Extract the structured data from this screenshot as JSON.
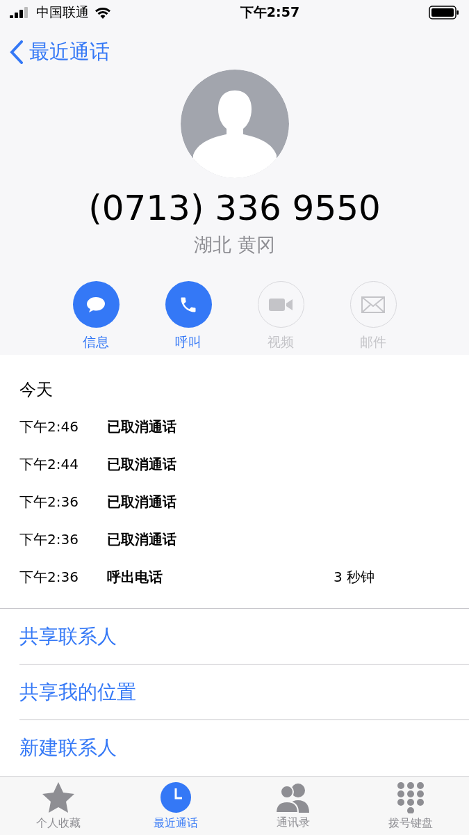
{
  "status_bar": {
    "carrier": "中国联通",
    "time": "下午2:57"
  },
  "nav": {
    "back_label": "最近通话"
  },
  "contact": {
    "number": "(0713) 336 9550",
    "location": "湖北 黄冈"
  },
  "actions": [
    {
      "kind": "message",
      "label": "信息",
      "disabled": false
    },
    {
      "kind": "call",
      "label": "呼叫",
      "disabled": false
    },
    {
      "kind": "video",
      "label": "视频",
      "disabled": true
    },
    {
      "kind": "mail",
      "label": "邮件",
      "disabled": true
    }
  ],
  "history": {
    "heading": "今天",
    "rows": [
      {
        "time": "下午2:46",
        "type": "已取消通话"
      },
      {
        "time": "下午2:44",
        "type": "已取消通话"
      },
      {
        "time": "下午2:36",
        "type": "已取消通话"
      },
      {
        "time": "下午2:36",
        "type": "已取消通话"
      },
      {
        "time": "下午2:36",
        "type": "呼出电话",
        "duration": "3 秒钟"
      }
    ]
  },
  "links": [
    "共享联系人",
    "共享我的位置",
    "新建联系人"
  ],
  "tab_bar": [
    {
      "kind": "favorites",
      "label": "个人收藏",
      "selected": false
    },
    {
      "kind": "recents",
      "label": "最近通话",
      "selected": true
    },
    {
      "kind": "contacts",
      "label": "通讯录",
      "selected": false
    },
    {
      "kind": "keypad",
      "label": "拨号键盘",
      "selected": false
    }
  ]
}
